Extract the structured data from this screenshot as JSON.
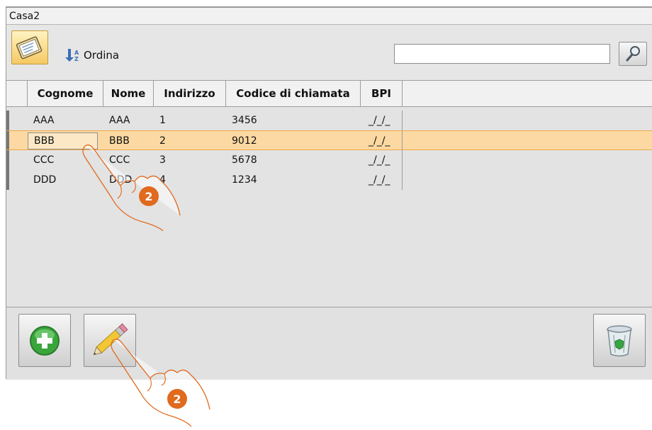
{
  "window": {
    "title": "Casa2"
  },
  "toolbar": {
    "sort_label": "Ordina",
    "search_value": ""
  },
  "table": {
    "columns": [
      "Cognome",
      "Nome",
      "Indirizzo",
      "Codice di chiamata",
      "BPI"
    ],
    "rows": [
      {
        "cognome": "AAA",
        "nome": "AAA",
        "indirizzo": "1",
        "codice": "3456",
        "bpi": "_/_/_"
      },
      {
        "cognome": "BBB",
        "nome": "BBB",
        "indirizzo": "2",
        "codice": "9012",
        "bpi": "_/_/_"
      },
      {
        "cognome": "CCC",
        "nome": "CCC",
        "indirizzo": "3",
        "codice": "5678",
        "bpi": "_/_/_"
      },
      {
        "cognome": "DDD",
        "nome": "DDD",
        "indirizzo": "4",
        "codice": "1234",
        "bpi": "_/_/_"
      }
    ],
    "selected_row": 1
  },
  "buttons": {
    "add_icon": "plus-icon",
    "edit_icon": "pencil-icon",
    "delete_icon": "trash-icon"
  },
  "callouts": {
    "step1": "2",
    "step2": "2"
  },
  "colors": {
    "selection": "#fcd9a2",
    "badge": "#e06a1e"
  }
}
